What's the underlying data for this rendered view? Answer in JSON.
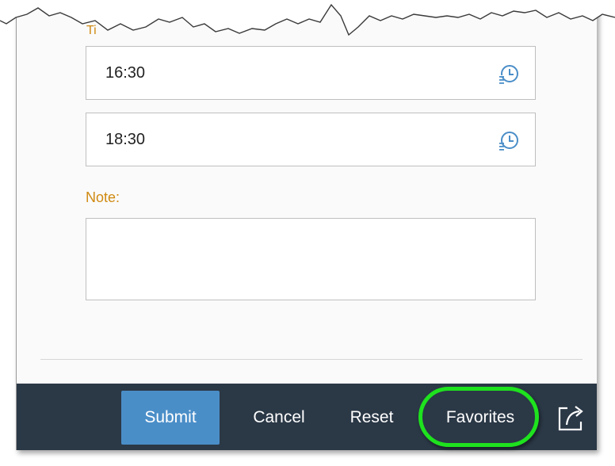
{
  "form": {
    "clipped_label": "Ti",
    "start_time": {
      "value": "16:30",
      "icon": "time-picker-icon"
    },
    "end_time": {
      "value": "18:30",
      "icon": "time-picker-icon"
    },
    "note_label": "Note:",
    "note_value": ""
  },
  "footer": {
    "submit_label": "Submit",
    "cancel_label": "Cancel",
    "reset_label": "Reset",
    "favorites_label": "Favorites",
    "share_icon": "share-icon"
  },
  "colors": {
    "label": "#d08a12",
    "footer_bg": "#2b3846",
    "primary_button": "#4a8ec8",
    "highlight": "#1ee21e"
  }
}
